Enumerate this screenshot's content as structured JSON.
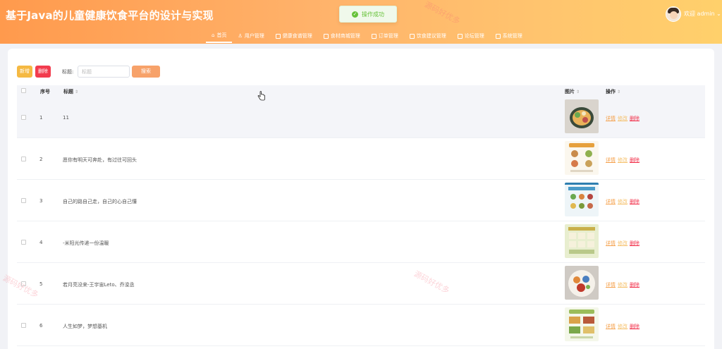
{
  "header": {
    "title": "基于Java的儿童健康饮食平台的设计与实现",
    "toast": "操作成功",
    "user": "欢迎 admin"
  },
  "nav": [
    {
      "label": "首页",
      "icon": "home-icon"
    },
    {
      "label": "用户管理",
      "icon": "user-icon"
    },
    {
      "label": "健康食谱管理",
      "icon": "recipe-icon"
    },
    {
      "label": "食材商城管理",
      "icon": "shop-icon"
    },
    {
      "label": "订单管理",
      "icon": "order-icon"
    },
    {
      "label": "饮食建议管理",
      "icon": "advice-icon"
    },
    {
      "label": "论坛管理",
      "icon": "forum-icon"
    },
    {
      "label": "系统管理",
      "icon": "system-icon"
    }
  ],
  "toolbar": {
    "add_label": "新增",
    "delete_label": "删除",
    "title_label": "标题:",
    "title_placeholder": "标题",
    "search_label": "搜索"
  },
  "table": {
    "columns": {
      "index": "序号",
      "title": "标题",
      "image": "图片",
      "actions": "操作"
    },
    "action_labels": {
      "detail": "详情",
      "edit": "修改",
      "delete": "删除"
    },
    "rows": [
      {
        "index": "1",
        "title": "11"
      },
      {
        "index": "2",
        "title": "愿你有明天可奔赴，有过往可回头"
      },
      {
        "index": "3",
        "title": "自己的路自己走，自己的心自己懂"
      },
      {
        "index": "4",
        "title": "-米阳光传递一份温暖"
      },
      {
        "index": "5",
        "title": "若月亮没来-王宇宙Leto、乔浚丞"
      },
      {
        "index": "6",
        "title": "人生如梦，梦想基机"
      }
    ]
  },
  "watermark": "源码好优多",
  "colors": {
    "accent": "#ff9a4d",
    "danger": "#f23c4e",
    "warning": "#f5b942",
    "success": "#67c23a"
  }
}
